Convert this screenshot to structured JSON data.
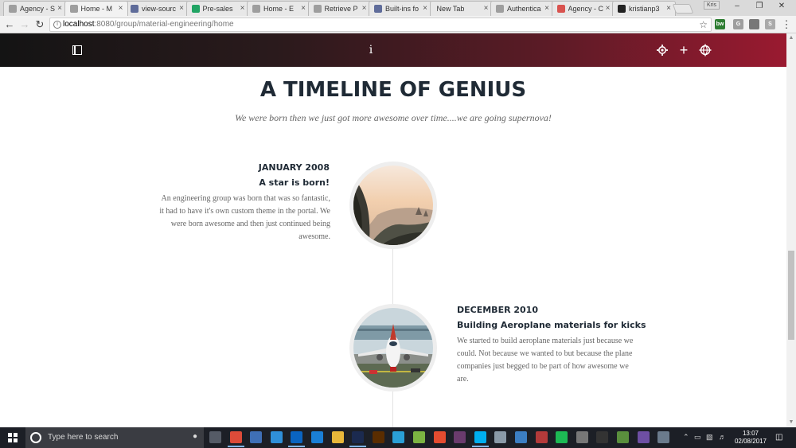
{
  "browser": {
    "tabs": [
      {
        "title": "Agency - S",
        "icon": "document-icon",
        "color": "#9e9e9e",
        "active": false
      },
      {
        "title": "Home - M",
        "icon": "document-icon",
        "color": "#9e9e9e",
        "active": true
      },
      {
        "title": "view-sourc",
        "icon": "page-icon",
        "color": "#5f6c9a",
        "active": false
      },
      {
        "title": "Pre-sales",
        "icon": "sheets-icon",
        "color": "#21a464",
        "active": false
      },
      {
        "title": "Home - E",
        "icon": "document-icon",
        "color": "#9e9e9e",
        "active": false
      },
      {
        "title": "Retrieve P",
        "icon": "document-icon",
        "color": "#9e9e9e",
        "active": false
      },
      {
        "title": "Built-ins fo",
        "icon": "page-icon",
        "color": "#5f6c9a",
        "active": false
      },
      {
        "title": "New Tab",
        "icon": "",
        "color": "",
        "active": false
      },
      {
        "title": "Authentica",
        "icon": "document-icon",
        "color": "#9e9e9e",
        "active": false
      },
      {
        "title": "Agency - C",
        "icon": "s-icon",
        "color": "#d9534f",
        "active": false
      },
      {
        "title": "kristianp3",
        "icon": "github-icon",
        "color": "#222222",
        "active": false
      }
    ],
    "user_badge": "Kris",
    "url_host": "localhost",
    "url_path": ":8080/group/material-engineering/home"
  },
  "site": {
    "title": "A TIMELINE OF GENIUS",
    "subtitle": "We were born then we just got more awesome over time....we are going supernova!",
    "info_glyph": "i"
  },
  "timeline": [
    {
      "date": "JANUARY 2008",
      "heading": "A star is born!",
      "body": "An engineering group was born that was so fantastic, it had to have it's own custom theme in the portal. We were born awesome and then just continued being awesome.",
      "image": "mountain-valley-photo"
    },
    {
      "date": "DECEMBER 2010",
      "heading": "Building Aeroplane materials for kicks",
      "body": "We started to build aeroplane materials just because we could. Not because we wanted to but because the plane companies just begged to be part of how awesome we are.",
      "image": "airplane-photo"
    }
  ],
  "taskbar": {
    "search_placeholder": "Type here to search",
    "time": "13:07",
    "date": "02/08/2017",
    "apps": [
      {
        "icon": "task-view-icon",
        "color": "#555b66"
      },
      {
        "icon": "chrome-icon",
        "color": "#dd4b39"
      },
      {
        "icon": "network-icon",
        "color": "#3f6fb5"
      },
      {
        "icon": "lightning-icon",
        "color": "#2f8fd8"
      },
      {
        "icon": "outlook-icon",
        "color": "#0a64c1"
      },
      {
        "icon": "edge-icon",
        "color": "#1a7fd6"
      },
      {
        "icon": "folder-icon",
        "color": "#e8b73a"
      },
      {
        "icon": "photoshop-icon",
        "color": "#1b2a4f"
      },
      {
        "icon": "illustrator-icon",
        "color": "#5a2d00"
      },
      {
        "icon": "ie-icon",
        "color": "#2a9fd6"
      },
      {
        "icon": "android-icon",
        "color": "#7cb342"
      },
      {
        "icon": "git-icon",
        "color": "#e44c30"
      },
      {
        "icon": "slack-icon",
        "color": "#6a3b6d"
      },
      {
        "icon": "skype-icon",
        "color": "#00aff0"
      },
      {
        "icon": "notes-icon",
        "color": "#8a9aa8"
      },
      {
        "icon": "remote-icon",
        "color": "#3c7ec2"
      },
      {
        "icon": "flag-icon",
        "color": "#b33a3a"
      },
      {
        "icon": "spotify-icon",
        "color": "#1db954"
      },
      {
        "icon": "gear-icon",
        "color": "#777777"
      },
      {
        "icon": "terminal-icon",
        "color": "#333333"
      },
      {
        "icon": "notepad-icon",
        "color": "#5a8f3d"
      },
      {
        "icon": "github-desktop-icon",
        "color": "#6e4fa3"
      },
      {
        "icon": "chat-icon",
        "color": "#6b7b8c"
      }
    ]
  }
}
